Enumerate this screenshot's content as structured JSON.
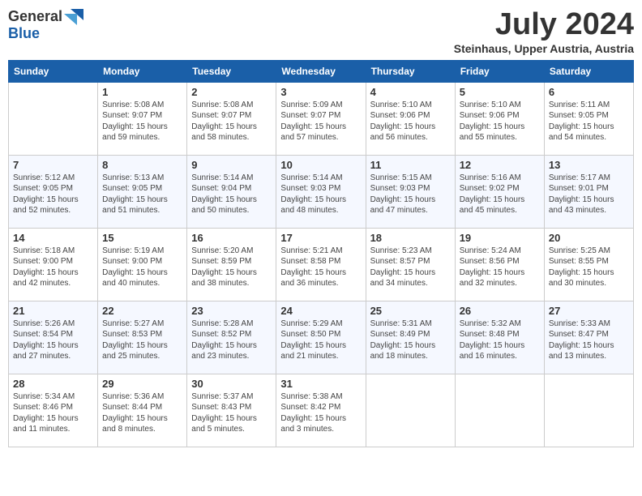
{
  "header": {
    "logo_general": "General",
    "logo_blue": "Blue",
    "month_title": "July 2024",
    "subtitle": "Steinhaus, Upper Austria, Austria"
  },
  "days_of_week": [
    "Sunday",
    "Monday",
    "Tuesday",
    "Wednesday",
    "Thursday",
    "Friday",
    "Saturday"
  ],
  "weeks": [
    [
      {
        "day": "",
        "info": ""
      },
      {
        "day": "1",
        "info": "Sunrise: 5:08 AM\nSunset: 9:07 PM\nDaylight: 15 hours\nand 59 minutes."
      },
      {
        "day": "2",
        "info": "Sunrise: 5:08 AM\nSunset: 9:07 PM\nDaylight: 15 hours\nand 58 minutes."
      },
      {
        "day": "3",
        "info": "Sunrise: 5:09 AM\nSunset: 9:07 PM\nDaylight: 15 hours\nand 57 minutes."
      },
      {
        "day": "4",
        "info": "Sunrise: 5:10 AM\nSunset: 9:06 PM\nDaylight: 15 hours\nand 56 minutes."
      },
      {
        "day": "5",
        "info": "Sunrise: 5:10 AM\nSunset: 9:06 PM\nDaylight: 15 hours\nand 55 minutes."
      },
      {
        "day": "6",
        "info": "Sunrise: 5:11 AM\nSunset: 9:05 PM\nDaylight: 15 hours\nand 54 minutes."
      }
    ],
    [
      {
        "day": "7",
        "info": "Sunrise: 5:12 AM\nSunset: 9:05 PM\nDaylight: 15 hours\nand 52 minutes."
      },
      {
        "day": "8",
        "info": "Sunrise: 5:13 AM\nSunset: 9:05 PM\nDaylight: 15 hours\nand 51 minutes."
      },
      {
        "day": "9",
        "info": "Sunrise: 5:14 AM\nSunset: 9:04 PM\nDaylight: 15 hours\nand 50 minutes."
      },
      {
        "day": "10",
        "info": "Sunrise: 5:14 AM\nSunset: 9:03 PM\nDaylight: 15 hours\nand 48 minutes."
      },
      {
        "day": "11",
        "info": "Sunrise: 5:15 AM\nSunset: 9:03 PM\nDaylight: 15 hours\nand 47 minutes."
      },
      {
        "day": "12",
        "info": "Sunrise: 5:16 AM\nSunset: 9:02 PM\nDaylight: 15 hours\nand 45 minutes."
      },
      {
        "day": "13",
        "info": "Sunrise: 5:17 AM\nSunset: 9:01 PM\nDaylight: 15 hours\nand 43 minutes."
      }
    ],
    [
      {
        "day": "14",
        "info": "Sunrise: 5:18 AM\nSunset: 9:00 PM\nDaylight: 15 hours\nand 42 minutes."
      },
      {
        "day": "15",
        "info": "Sunrise: 5:19 AM\nSunset: 9:00 PM\nDaylight: 15 hours\nand 40 minutes."
      },
      {
        "day": "16",
        "info": "Sunrise: 5:20 AM\nSunset: 8:59 PM\nDaylight: 15 hours\nand 38 minutes."
      },
      {
        "day": "17",
        "info": "Sunrise: 5:21 AM\nSunset: 8:58 PM\nDaylight: 15 hours\nand 36 minutes."
      },
      {
        "day": "18",
        "info": "Sunrise: 5:23 AM\nSunset: 8:57 PM\nDaylight: 15 hours\nand 34 minutes."
      },
      {
        "day": "19",
        "info": "Sunrise: 5:24 AM\nSunset: 8:56 PM\nDaylight: 15 hours\nand 32 minutes."
      },
      {
        "day": "20",
        "info": "Sunrise: 5:25 AM\nSunset: 8:55 PM\nDaylight: 15 hours\nand 30 minutes."
      }
    ],
    [
      {
        "day": "21",
        "info": "Sunrise: 5:26 AM\nSunset: 8:54 PM\nDaylight: 15 hours\nand 27 minutes."
      },
      {
        "day": "22",
        "info": "Sunrise: 5:27 AM\nSunset: 8:53 PM\nDaylight: 15 hours\nand 25 minutes."
      },
      {
        "day": "23",
        "info": "Sunrise: 5:28 AM\nSunset: 8:52 PM\nDaylight: 15 hours\nand 23 minutes."
      },
      {
        "day": "24",
        "info": "Sunrise: 5:29 AM\nSunset: 8:50 PM\nDaylight: 15 hours\nand 21 minutes."
      },
      {
        "day": "25",
        "info": "Sunrise: 5:31 AM\nSunset: 8:49 PM\nDaylight: 15 hours\nand 18 minutes."
      },
      {
        "day": "26",
        "info": "Sunrise: 5:32 AM\nSunset: 8:48 PM\nDaylight: 15 hours\nand 16 minutes."
      },
      {
        "day": "27",
        "info": "Sunrise: 5:33 AM\nSunset: 8:47 PM\nDaylight: 15 hours\nand 13 minutes."
      }
    ],
    [
      {
        "day": "28",
        "info": "Sunrise: 5:34 AM\nSunset: 8:46 PM\nDaylight: 15 hours\nand 11 minutes."
      },
      {
        "day": "29",
        "info": "Sunrise: 5:36 AM\nSunset: 8:44 PM\nDaylight: 15 hours\nand 8 minutes."
      },
      {
        "day": "30",
        "info": "Sunrise: 5:37 AM\nSunset: 8:43 PM\nDaylight: 15 hours\nand 5 minutes."
      },
      {
        "day": "31",
        "info": "Sunrise: 5:38 AM\nSunset: 8:42 PM\nDaylight: 15 hours\nand 3 minutes."
      },
      {
        "day": "",
        "info": ""
      },
      {
        "day": "",
        "info": ""
      },
      {
        "day": "",
        "info": ""
      }
    ]
  ]
}
